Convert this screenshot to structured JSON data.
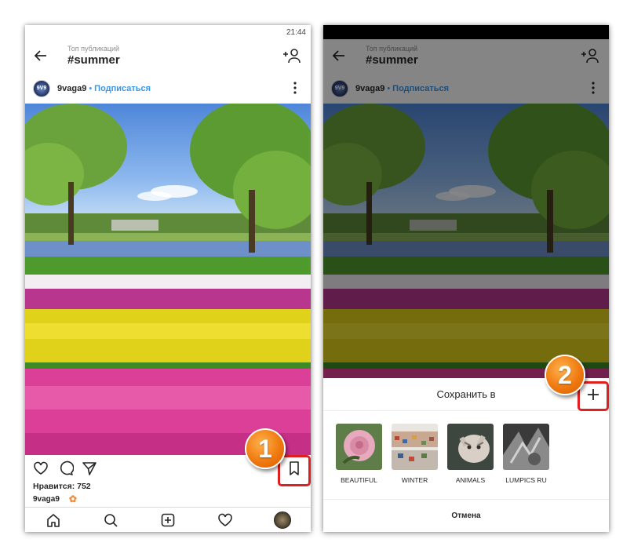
{
  "left_screen": {
    "status_time": "21:44",
    "header": {
      "subtitle": "Топ публикаций",
      "title": "#summer"
    },
    "post": {
      "username": "9vaga9",
      "separator": "•",
      "follow_label": "Подписаться",
      "likes": "Нравится: 752",
      "caption_user": "9vaga9"
    },
    "badge": "1"
  },
  "right_screen": {
    "header": {
      "subtitle": "Топ публикаций",
      "title": "#summer"
    },
    "post": {
      "username": "9vaga9",
      "separator": "•",
      "follow_label": "Подписаться"
    },
    "sheet": {
      "title": "Сохранить в",
      "collections": [
        {
          "label": "BEAUTIFUL"
        },
        {
          "label": "WINTER"
        },
        {
          "label": "ANIMALS"
        },
        {
          "label": "LUMPICS RU"
        }
      ],
      "cancel_label": "Отмена"
    },
    "badge": "2"
  },
  "colors": {
    "link": "#3897f0",
    "highlight": "#e02020",
    "badge": "#f07a10"
  }
}
